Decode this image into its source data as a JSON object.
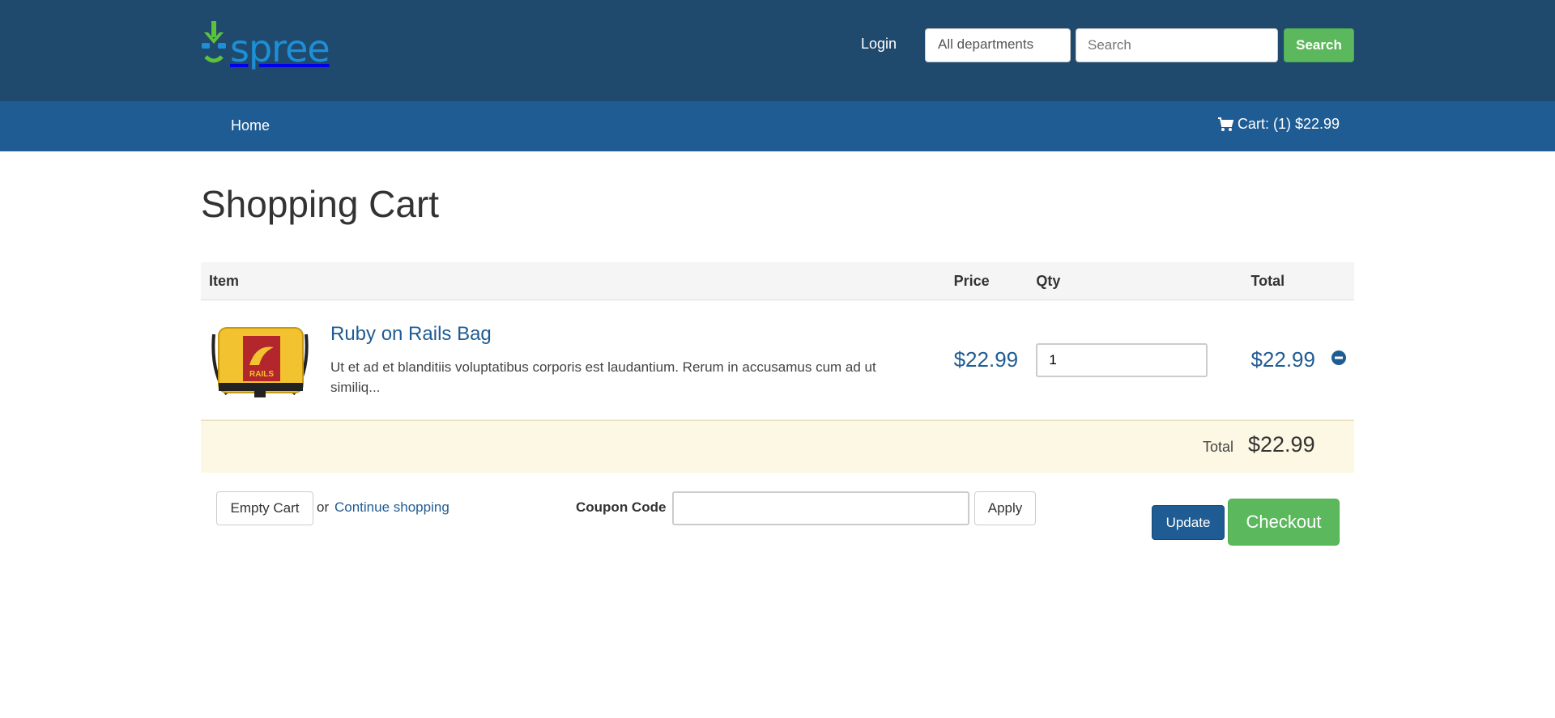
{
  "header": {
    "brand": "spree",
    "login_label": "Login",
    "department_select": "All departments",
    "search_placeholder": "Search",
    "search_button": "Search",
    "brand_color": "#1e8fd6",
    "accent_green": "#5cb85c",
    "header_bg": "#1f4a6e"
  },
  "nav": {
    "home_label": "Home",
    "cart_label": "Cart: (1) $22.99",
    "cart_icon": "cart-icon",
    "nav_bg": "#1f5c93"
  },
  "page": {
    "title": "Shopping Cart"
  },
  "cart_table": {
    "headers": [
      "Item",
      "Price",
      "Qty",
      "Total",
      ""
    ],
    "rows": [
      {
        "name": "Ruby on Rails Bag",
        "description": "Ut et ad et blanditiis voluptatibus corporis est laudantium. Rerum in accusamus cum ad ut similiq...",
        "image_icon": "rails-bag-image",
        "image_text": "RAILS",
        "price": "$22.99",
        "quantity": "1",
        "total": "$22.99",
        "remove_icon": "remove-icon"
      }
    ],
    "total_label": "Total",
    "total_value": "$22.99"
  },
  "actions": {
    "empty_cart": "Empty Cart",
    "or_text": "or",
    "continue_shopping": "Continue shopping",
    "coupon_label": "Coupon Code",
    "coupon_value": "",
    "apply": "Apply",
    "update": "Update",
    "checkout": "Checkout"
  }
}
